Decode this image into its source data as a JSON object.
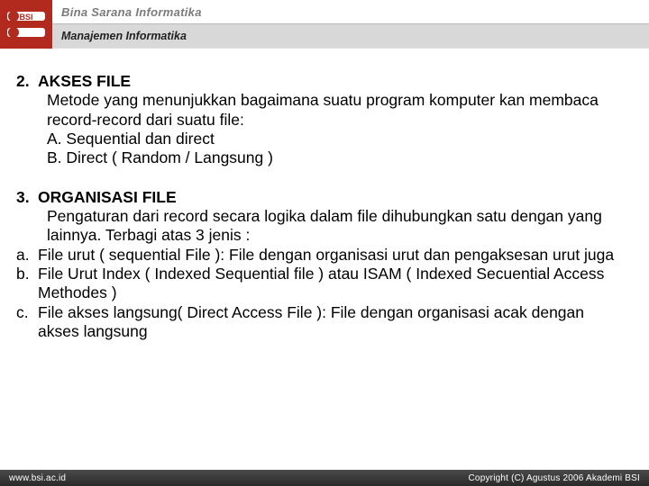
{
  "header": {
    "org": "Bina Sarana Informatika",
    "dept": "Manajemen Informatika"
  },
  "section2": {
    "num": "2.",
    "title": "AKSES FILE",
    "desc": "Metode yang menunjukkan bagaimana suatu program komputer kan membaca record-record dari suatu file:",
    "item_a": "A. Sequential dan direct",
    "item_b": "B. Direct ( Random / Langsung )"
  },
  "section3": {
    "num": "3.",
    "title": "ORGANISASI FILE",
    "desc": "Pengaturan dari record secara logika dalam file dihubungkan satu dengan yang lainnya. Terbagi atas 3 jenis :",
    "a_lbl": "a.",
    "a_txt": "File urut ( sequential File ): File dengan organisasi urut dan pengaksesan urut juga",
    "b_lbl": "b.",
    "b_txt": "File Urut Index ( Indexed Sequential file ) atau ISAM ( Indexed Secuential Access Methodes )",
    "c_lbl": "c.",
    "c_txt": "File akses langsung( Direct Access File ): File dengan organisasi acak dengan akses   langsung"
  },
  "footer": {
    "left": "www.bsi.ac.id",
    "right": "Copyright (C) Agustus 2006 Akademi BSI"
  }
}
